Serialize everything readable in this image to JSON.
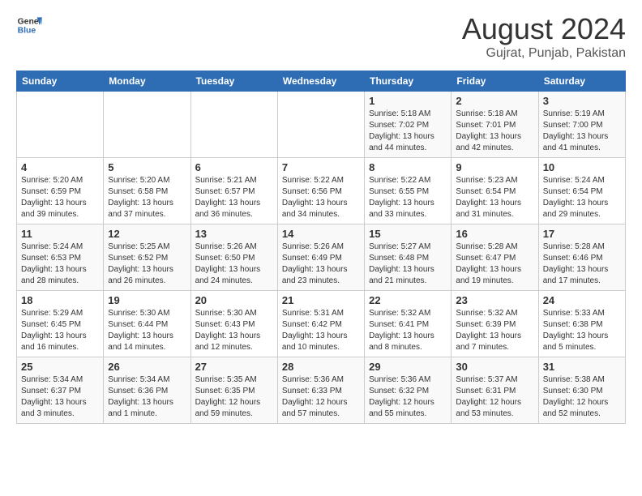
{
  "header": {
    "logo_general": "General",
    "logo_blue": "Blue",
    "month_year": "August 2024",
    "location": "Gujrat, Punjab, Pakistan"
  },
  "weekdays": [
    "Sunday",
    "Monday",
    "Tuesday",
    "Wednesday",
    "Thursday",
    "Friday",
    "Saturday"
  ],
  "weeks": [
    [
      {
        "day": "",
        "info": ""
      },
      {
        "day": "",
        "info": ""
      },
      {
        "day": "",
        "info": ""
      },
      {
        "day": "",
        "info": ""
      },
      {
        "day": "1",
        "info": "Sunrise: 5:18 AM\nSunset: 7:02 PM\nDaylight: 13 hours\nand 44 minutes."
      },
      {
        "day": "2",
        "info": "Sunrise: 5:18 AM\nSunset: 7:01 PM\nDaylight: 13 hours\nand 42 minutes."
      },
      {
        "day": "3",
        "info": "Sunrise: 5:19 AM\nSunset: 7:00 PM\nDaylight: 13 hours\nand 41 minutes."
      }
    ],
    [
      {
        "day": "4",
        "info": "Sunrise: 5:20 AM\nSunset: 6:59 PM\nDaylight: 13 hours\nand 39 minutes."
      },
      {
        "day": "5",
        "info": "Sunrise: 5:20 AM\nSunset: 6:58 PM\nDaylight: 13 hours\nand 37 minutes."
      },
      {
        "day": "6",
        "info": "Sunrise: 5:21 AM\nSunset: 6:57 PM\nDaylight: 13 hours\nand 36 minutes."
      },
      {
        "day": "7",
        "info": "Sunrise: 5:22 AM\nSunset: 6:56 PM\nDaylight: 13 hours\nand 34 minutes."
      },
      {
        "day": "8",
        "info": "Sunrise: 5:22 AM\nSunset: 6:55 PM\nDaylight: 13 hours\nand 33 minutes."
      },
      {
        "day": "9",
        "info": "Sunrise: 5:23 AM\nSunset: 6:54 PM\nDaylight: 13 hours\nand 31 minutes."
      },
      {
        "day": "10",
        "info": "Sunrise: 5:24 AM\nSunset: 6:54 PM\nDaylight: 13 hours\nand 29 minutes."
      }
    ],
    [
      {
        "day": "11",
        "info": "Sunrise: 5:24 AM\nSunset: 6:53 PM\nDaylight: 13 hours\nand 28 minutes."
      },
      {
        "day": "12",
        "info": "Sunrise: 5:25 AM\nSunset: 6:52 PM\nDaylight: 13 hours\nand 26 minutes."
      },
      {
        "day": "13",
        "info": "Sunrise: 5:26 AM\nSunset: 6:50 PM\nDaylight: 13 hours\nand 24 minutes."
      },
      {
        "day": "14",
        "info": "Sunrise: 5:26 AM\nSunset: 6:49 PM\nDaylight: 13 hours\nand 23 minutes."
      },
      {
        "day": "15",
        "info": "Sunrise: 5:27 AM\nSunset: 6:48 PM\nDaylight: 13 hours\nand 21 minutes."
      },
      {
        "day": "16",
        "info": "Sunrise: 5:28 AM\nSunset: 6:47 PM\nDaylight: 13 hours\nand 19 minutes."
      },
      {
        "day": "17",
        "info": "Sunrise: 5:28 AM\nSunset: 6:46 PM\nDaylight: 13 hours\nand 17 minutes."
      }
    ],
    [
      {
        "day": "18",
        "info": "Sunrise: 5:29 AM\nSunset: 6:45 PM\nDaylight: 13 hours\nand 16 minutes."
      },
      {
        "day": "19",
        "info": "Sunrise: 5:30 AM\nSunset: 6:44 PM\nDaylight: 13 hours\nand 14 minutes."
      },
      {
        "day": "20",
        "info": "Sunrise: 5:30 AM\nSunset: 6:43 PM\nDaylight: 13 hours\nand 12 minutes."
      },
      {
        "day": "21",
        "info": "Sunrise: 5:31 AM\nSunset: 6:42 PM\nDaylight: 13 hours\nand 10 minutes."
      },
      {
        "day": "22",
        "info": "Sunrise: 5:32 AM\nSunset: 6:41 PM\nDaylight: 13 hours\nand 8 minutes."
      },
      {
        "day": "23",
        "info": "Sunrise: 5:32 AM\nSunset: 6:39 PM\nDaylight: 13 hours\nand 7 minutes."
      },
      {
        "day": "24",
        "info": "Sunrise: 5:33 AM\nSunset: 6:38 PM\nDaylight: 13 hours\nand 5 minutes."
      }
    ],
    [
      {
        "day": "25",
        "info": "Sunrise: 5:34 AM\nSunset: 6:37 PM\nDaylight: 13 hours\nand 3 minutes."
      },
      {
        "day": "26",
        "info": "Sunrise: 5:34 AM\nSunset: 6:36 PM\nDaylight: 13 hours\nand 1 minute."
      },
      {
        "day": "27",
        "info": "Sunrise: 5:35 AM\nSunset: 6:35 PM\nDaylight: 12 hours\nand 59 minutes."
      },
      {
        "day": "28",
        "info": "Sunrise: 5:36 AM\nSunset: 6:33 PM\nDaylight: 12 hours\nand 57 minutes."
      },
      {
        "day": "29",
        "info": "Sunrise: 5:36 AM\nSunset: 6:32 PM\nDaylight: 12 hours\nand 55 minutes."
      },
      {
        "day": "30",
        "info": "Sunrise: 5:37 AM\nSunset: 6:31 PM\nDaylight: 12 hours\nand 53 minutes."
      },
      {
        "day": "31",
        "info": "Sunrise: 5:38 AM\nSunset: 6:30 PM\nDaylight: 12 hours\nand 52 minutes."
      }
    ]
  ]
}
